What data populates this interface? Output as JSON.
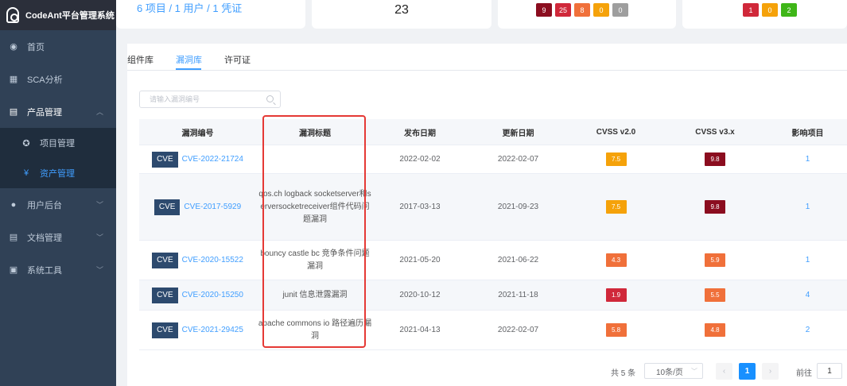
{
  "app": {
    "title": "CodeAnt平台管理系统"
  },
  "sidebar": {
    "items": [
      {
        "label": "首页",
        "icon": "dashboard-icon"
      },
      {
        "label": "SCA分析",
        "icon": "grid-icon"
      },
      {
        "label": "产品管理",
        "icon": "document-icon"
      },
      {
        "label": "项目管理",
        "icon": "target-icon"
      },
      {
        "label": "资产管理",
        "icon": "yen-icon"
      },
      {
        "label": "用户后台",
        "icon": "user-icon"
      },
      {
        "label": "文档管理",
        "icon": "doc-icon"
      },
      {
        "label": "系统工具",
        "icon": "toolbox-icon"
      }
    ]
  },
  "stats": {
    "summary": "6 项目 / 1 用户 / 1 凭证",
    "count": "23",
    "severity_badges": [
      {
        "value": "9",
        "color": "#8b0d1f"
      },
      {
        "value": "25",
        "color": "#d0283a"
      },
      {
        "value": "8",
        "color": "#f0703a"
      },
      {
        "value": "0",
        "color": "#f5a20a"
      },
      {
        "value": "0",
        "color": "#9e9e9e"
      }
    ],
    "license_badges": [
      {
        "value": "1",
        "color": "#d0283a"
      },
      {
        "value": "0",
        "color": "#f5a20a"
      },
      {
        "value": "2",
        "color": "#3fb618"
      }
    ]
  },
  "tabs": [
    {
      "label": "组件库",
      "active": false
    },
    {
      "label": "漏洞库",
      "active": true
    },
    {
      "label": "许可证",
      "active": false
    }
  ],
  "search": {
    "placeholder": "请输入漏洞编号"
  },
  "table": {
    "headers": [
      "漏洞编号",
      "漏洞标题",
      "发布日期",
      "更新日期",
      "CVSS v2.0",
      "CVSS v3.x",
      "影响项目"
    ],
    "tag": "CVE",
    "rows": [
      {
        "id": "CVE-2022-21724",
        "title": "",
        "published": "2022-02-02",
        "updated": "2022-02-07",
        "cvss2": "7.5",
        "cvss2_color": "#f5a20a",
        "cvss3": "9.8",
        "cvss3_color": "#8b0d1f",
        "projects": "1"
      },
      {
        "id": "CVE-2017-5929",
        "title": "qos.ch logback socketserver和serversocketreceiver组件代码问题漏洞",
        "published": "2017-03-13",
        "updated": "2021-09-23",
        "cvss2": "7.5",
        "cvss2_color": "#f5a20a",
        "cvss3": "9.8",
        "cvss3_color": "#8b0d1f",
        "projects": "1"
      },
      {
        "id": "CVE-2020-15522",
        "title": "bouncy castle bc 竞争条件问题漏洞",
        "published": "2021-05-20",
        "updated": "2021-06-22",
        "cvss2": "4.3",
        "cvss2_color": "#f0703a",
        "cvss3": "5.9",
        "cvss3_color": "#f0703a",
        "projects": "1"
      },
      {
        "id": "CVE-2020-15250",
        "title": "junit 信息泄露漏洞",
        "published": "2020-10-12",
        "updated": "2021-11-18",
        "cvss2": "1.9",
        "cvss2_color": "#d0283a",
        "cvss3": "5.5",
        "cvss3_color": "#f0703a",
        "projects": "4"
      },
      {
        "id": "CVE-2021-29425",
        "title": "apache commons io 路径遍历漏洞",
        "published": "2021-04-13",
        "updated": "2022-02-07",
        "cvss2": "5.8",
        "cvss2_color": "#f0703a",
        "cvss3": "4.8",
        "cvss3_color": "#f0703a",
        "projects": "2"
      }
    ]
  },
  "pagination": {
    "total": "共 5 条",
    "page_size": "10条/页",
    "current_page": "1",
    "jump_label": "前往",
    "jump_value": "1"
  }
}
